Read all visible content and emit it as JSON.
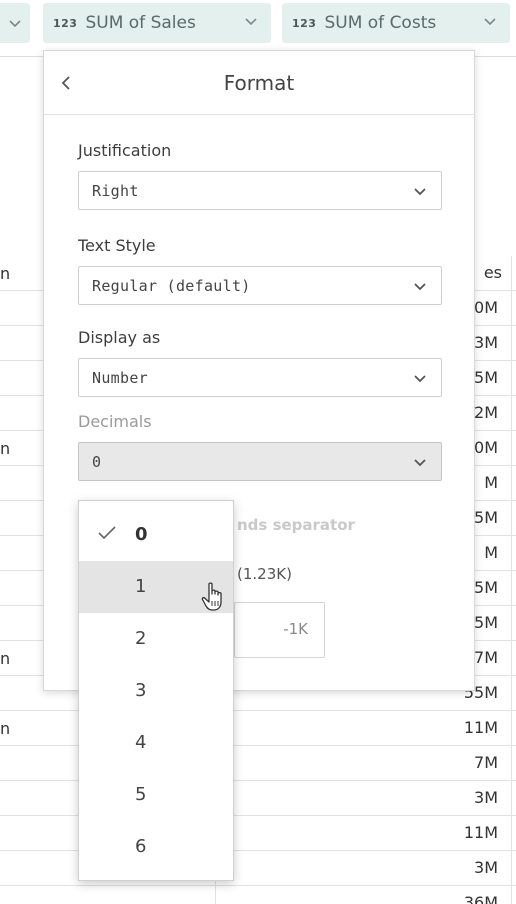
{
  "chips": {
    "sales": {
      "type": "123",
      "label": "SUM of Sales"
    },
    "costs": {
      "type": "123",
      "label": "SUM of Costs"
    }
  },
  "table": {
    "header": {
      "c1": "n",
      "c2": "es"
    },
    "rows": [
      {
        "c1": "",
        "c2": "0M"
      },
      {
        "c1": "",
        "c2": "3M"
      },
      {
        "c1": "",
        "c2": "5M"
      },
      {
        "c1": "",
        "c2": "2M"
      },
      {
        "c1": "n",
        "c2": "0M"
      },
      {
        "c1": "",
        "c2": "M"
      },
      {
        "c1": "",
        "c2": "5M"
      },
      {
        "c1": "",
        "c2": "M"
      },
      {
        "c1": "",
        "c2": "5M"
      },
      {
        "c1": "",
        "c2": "5M"
      },
      {
        "c1": "n",
        "c2": "7M"
      },
      {
        "c1": "",
        "c2": "55M"
      },
      {
        "c1": "n",
        "c2": "11M"
      },
      {
        "c1": "",
        "c2": "7M"
      },
      {
        "c1": "",
        "c2": "3M"
      },
      {
        "c1": "",
        "c2": "11M"
      },
      {
        "c1": "",
        "c2": "3M"
      },
      {
        "c1": "",
        "c2": "36M"
      }
    ]
  },
  "panel": {
    "title": "Format",
    "justification": {
      "label": "Justification",
      "value": "Right"
    },
    "text_style": {
      "label": "Text Style",
      "value": "Regular (default)"
    },
    "display_as": {
      "label": "Display as",
      "value": "Number"
    },
    "decimals": {
      "label": "Decimals",
      "value": "0"
    },
    "separator_label": "nds separator",
    "example_label": "(1.23K)",
    "example_value": "-1K"
  },
  "dropdown": {
    "options": [
      "0",
      "1",
      "2",
      "3",
      "4",
      "5",
      "6"
    ],
    "selected": "0",
    "hovered": "1"
  }
}
